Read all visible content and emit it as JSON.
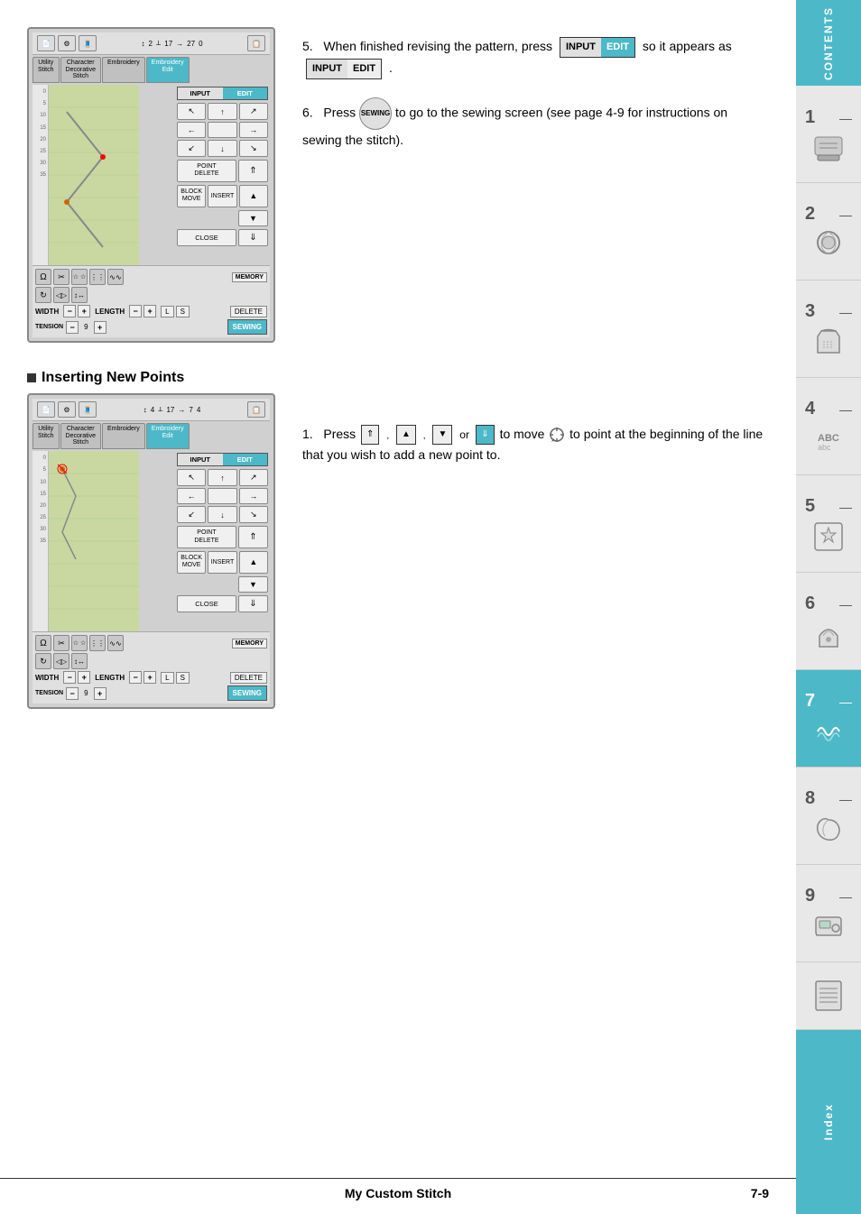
{
  "page": {
    "title": "My Custom Stitch",
    "page_number": "7-9"
  },
  "sidebar": {
    "contents_label": "CONTENTS",
    "index_label": "Index",
    "tabs": [
      {
        "num": "1",
        "dash": "—",
        "icon": "hand-sewing"
      },
      {
        "num": "2",
        "dash": "—",
        "icon": "thread"
      },
      {
        "num": "3",
        "dash": "—",
        "icon": "shirt"
      },
      {
        "num": "4",
        "dash": "—",
        "icon": "abc"
      },
      {
        "num": "5",
        "dash": "—",
        "icon": "star"
      },
      {
        "num": "6",
        "dash": "—",
        "icon": "hat"
      },
      {
        "num": "7",
        "dash": "—",
        "icon": "wave"
      },
      {
        "num": "8",
        "dash": "—",
        "icon": "loop"
      },
      {
        "num": "9",
        "dash": "—",
        "icon": "machine"
      }
    ]
  },
  "section1": {
    "steps": [
      {
        "number": "5.",
        "text": "When finished revising the pattern, press",
        "button_input": "INPUT",
        "button_edit": "EDIT",
        "text2": "so it appears as",
        "button2_input": "INPUT",
        "button2_edit": "EDIT",
        "text3": "."
      },
      {
        "number": "6.",
        "text": "Press",
        "button_sewing": "SEWING",
        "text2": "to go to the sewing screen (see page 4-9 for instructions on sewing the stitch)."
      }
    ]
  },
  "section2": {
    "heading": "Inserting New Points",
    "step1": {
      "number": "1.",
      "text": "Press",
      "buttons": [
        "▲̈",
        "▲",
        "▼",
        "▼̈"
      ],
      "text2": "or",
      "text3": "to move",
      "cursor_icon": "crosshair",
      "text4": "to point at the beginning of the line that you wish to add a new point to."
    }
  },
  "machine_ui": {
    "tabs": [
      {
        "label": "Utility\nStitch",
        "active": false
      },
      {
        "label": "Character\nDecorative\nStitch",
        "active": false
      },
      {
        "label": "Embroidery",
        "active": false
      },
      {
        "label": "Embroidery\nEdit",
        "active": true
      }
    ],
    "display": {
      "counter1": "2",
      "counter2": "17",
      "counter3": "27",
      "counter4": "0"
    },
    "buttons": {
      "input_edit": {
        "input": "INPUT",
        "edit": "EDIT"
      },
      "arrows": [
        "↖",
        "↑",
        "↗",
        "←",
        "",
        "→",
        "↙",
        "↓",
        "↘"
      ],
      "point_delete": "POINT\nDELETE",
      "block_move": "BLOCK\nMOVE",
      "insert": "INSERT",
      "close": "CLOSE"
    },
    "bottom": {
      "width_label": "WIDTH",
      "length_label": "LENGTH",
      "delete_label": "DELETE",
      "tension_label": "TENSION",
      "sewing_label": "SEWING",
      "ls_options": [
        "L",
        "S"
      ]
    }
  }
}
